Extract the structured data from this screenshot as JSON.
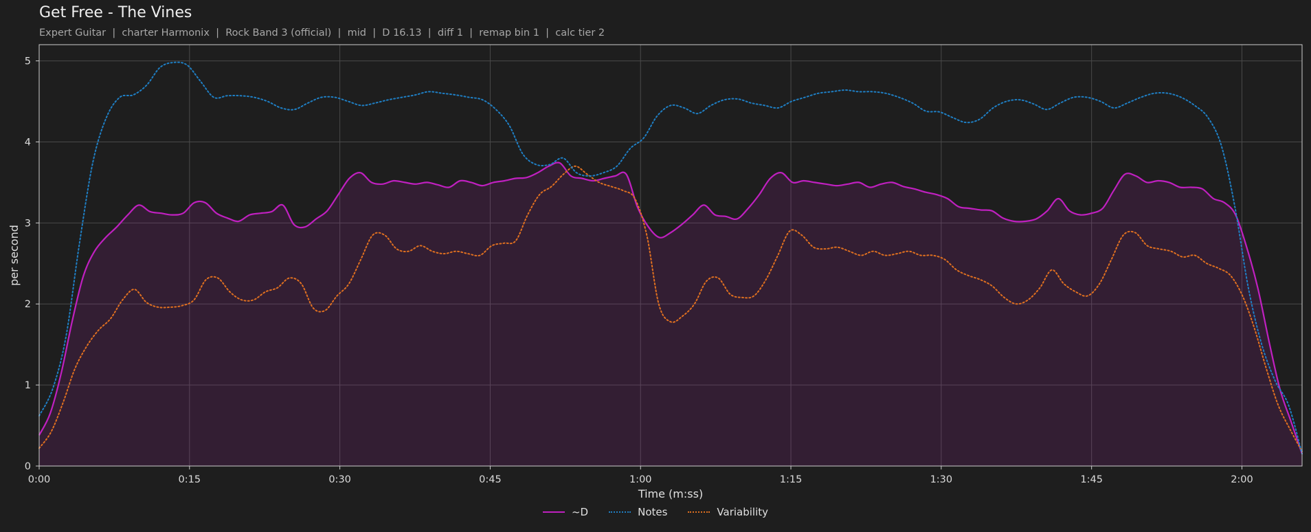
{
  "title": "Get Free - The Vines",
  "subtitle": "Expert Guitar  |  charter Harmonix  |  Rock Band 3 (official)  |  mid  |  D 16.13  |  diff 1  |  remap bin 1  |  calc tier 2",
  "chart_data": {
    "type": "line",
    "xlabel": "Time (m:ss)",
    "ylabel": "per second",
    "xlim": [
      0,
      126
    ],
    "ylim": [
      0,
      5.2
    ],
    "x_ticks": [
      0,
      15,
      30,
      45,
      60,
      75,
      90,
      105,
      120
    ],
    "x_tick_labels": [
      "0:00",
      "0:15",
      "0:30",
      "0:45",
      "1:00",
      "1:15",
      "1:30",
      "1:45",
      "2:00"
    ],
    "y_ticks": [
      0,
      1,
      2,
      3,
      4,
      5
    ],
    "y_tick_labels": [
      "0",
      "1",
      "2",
      "3",
      "4",
      "5"
    ],
    "grid": true,
    "legend_position": "bottom-center",
    "x": [
      0,
      1,
      2,
      3,
      4,
      5,
      6,
      7,
      8,
      9,
      10,
      11,
      12,
      13,
      14,
      15,
      16,
      17,
      18,
      19,
      20,
      21,
      22,
      23,
      24,
      25,
      26,
      27,
      28,
      29,
      30,
      31,
      32,
      33,
      34,
      35,
      36,
      37,
      38,
      39,
      40,
      41,
      42,
      43,
      44,
      45,
      46,
      47,
      48,
      49,
      50,
      51,
      52,
      53,
      54,
      55,
      56,
      57,
      58,
      59,
      60,
      61,
      62,
      63,
      64,
      65,
      66,
      67,
      68,
      69,
      70,
      71,
      72,
      73,
      74,
      75,
      76,
      77,
      78,
      79,
      80,
      81,
      82,
      83,
      84,
      85,
      86,
      87,
      88,
      89,
      90,
      91,
      92,
      93,
      94,
      95,
      96,
      97,
      98,
      99,
      100,
      101,
      102,
      103,
      104,
      105,
      106,
      107,
      108,
      109,
      110,
      111,
      112,
      113,
      114,
      115,
      116,
      117,
      118,
      119,
      120,
      121,
      122,
      123,
      124,
      125,
      126
    ],
    "series": [
      {
        "name": "~D",
        "color": "#c020c0",
        "style": "solid",
        "fill": true,
        "values": [
          0.38,
          0.65,
          1.15,
          1.8,
          2.35,
          2.65,
          2.82,
          2.95,
          3.1,
          3.22,
          3.14,
          3.12,
          3.1,
          3.12,
          3.25,
          3.25,
          3.12,
          3.06,
          3.02,
          3.1,
          3.12,
          3.14,
          3.22,
          2.98,
          2.95,
          3.05,
          3.15,
          3.35,
          3.55,
          3.62,
          3.5,
          3.48,
          3.52,
          3.5,
          3.48,
          3.5,
          3.47,
          3.44,
          3.52,
          3.5,
          3.46,
          3.5,
          3.52,
          3.55,
          3.56,
          3.62,
          3.7,
          3.74,
          3.58,
          3.55,
          3.52,
          3.55,
          3.58,
          3.6,
          3.2,
          2.95,
          2.82,
          2.88,
          2.98,
          3.1,
          3.22,
          3.1,
          3.08,
          3.05,
          3.18,
          3.35,
          3.55,
          3.62,
          3.5,
          3.52,
          3.5,
          3.48,
          3.46,
          3.48,
          3.5,
          3.44,
          3.48,
          3.5,
          3.45,
          3.42,
          3.38,
          3.35,
          3.3,
          3.2,
          3.18,
          3.16,
          3.15,
          3.06,
          3.02,
          3.02,
          3.05,
          3.15,
          3.3,
          3.15,
          3.1,
          3.12,
          3.18,
          3.4,
          3.6,
          3.58,
          3.5,
          3.52,
          3.5,
          3.44,
          3.44,
          3.42,
          3.3,
          3.25,
          3.1,
          2.7,
          2.2,
          1.55,
          0.95,
          0.55,
          0.15
        ]
      },
      {
        "name": "Notes",
        "color": "#1f7fc4",
        "style": "dotted",
        "fill": false,
        "values": [
          0.62,
          0.95,
          1.6,
          2.75,
          3.75,
          4.3,
          4.55,
          4.58,
          4.7,
          4.92,
          4.98,
          4.95,
          4.75,
          4.55,
          4.57,
          4.57,
          4.55,
          4.5,
          4.42,
          4.4,
          4.48,
          4.55,
          4.55,
          4.5,
          4.45,
          4.48,
          4.52,
          4.55,
          4.58,
          4.62,
          4.6,
          4.58,
          4.55,
          4.52,
          4.4,
          4.2,
          3.85,
          3.72,
          3.72,
          3.8,
          3.62,
          3.58,
          3.62,
          3.7,
          3.92,
          4.05,
          4.32,
          4.45,
          4.42,
          4.35,
          4.45,
          4.52,
          4.53,
          4.48,
          4.45,
          4.42,
          4.5,
          4.55,
          4.6,
          4.62,
          4.64,
          4.62,
          4.62,
          4.6,
          4.55,
          4.48,
          4.38,
          4.37,
          4.3,
          4.24,
          4.28,
          4.42,
          4.5,
          4.52,
          4.47,
          4.4,
          4.48,
          4.55,
          4.55,
          4.5,
          4.42,
          4.48,
          4.55,
          4.6,
          4.6,
          4.55,
          4.45,
          4.3,
          3.95,
          3.2,
          2.2,
          1.5,
          1.05,
          0.75,
          0.15
        ]
      },
      {
        "name": "Variability",
        "color": "#e07020",
        "style": "dotted",
        "fill": false,
        "values": [
          0.22,
          0.42,
          0.78,
          1.2,
          1.48,
          1.68,
          1.82,
          2.05,
          2.18,
          2.02,
          1.96,
          1.96,
          1.98,
          2.05,
          2.3,
          2.32,
          2.15,
          2.05,
          2.05,
          2.15,
          2.2,
          2.32,
          2.25,
          1.95,
          1.92,
          2.1,
          2.25,
          2.55,
          2.85,
          2.85,
          2.68,
          2.65,
          2.72,
          2.65,
          2.62,
          2.65,
          2.62,
          2.6,
          2.72,
          2.75,
          2.78,
          3.1,
          3.35,
          3.45,
          3.6,
          3.7,
          3.6,
          3.5,
          3.45,
          3.4,
          3.3,
          2.85,
          2.0,
          1.78,
          1.85,
          2.0,
          2.28,
          2.32,
          2.12,
          2.08,
          2.1,
          2.3,
          2.6,
          2.9,
          2.85,
          2.7,
          2.68,
          2.7,
          2.65,
          2.6,
          2.65,
          2.6,
          2.62,
          2.65,
          2.6,
          2.6,
          2.55,
          2.42,
          2.35,
          2.3,
          2.22,
          2.08,
          2.0,
          2.05,
          2.2,
          2.42,
          2.25,
          2.15,
          2.1,
          2.25,
          2.55,
          2.85,
          2.88,
          2.72,
          2.68,
          2.65,
          2.58,
          2.6,
          2.5,
          2.44,
          2.35,
          2.1,
          1.7,
          1.2,
          0.75,
          0.45,
          0.18
        ]
      }
    ]
  }
}
